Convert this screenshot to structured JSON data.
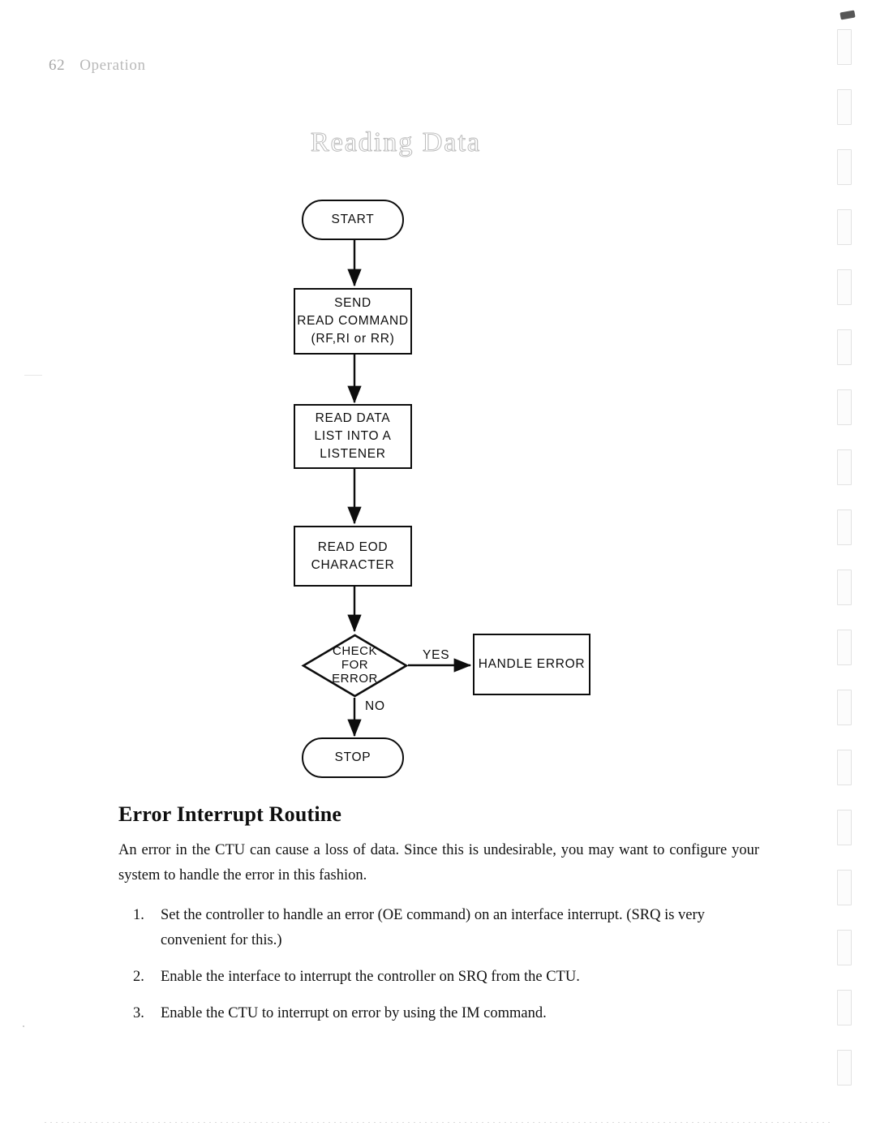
{
  "page": {
    "number": "62",
    "running_head": "Operation",
    "section_title": "Reading Data"
  },
  "flowchart": {
    "nodes": [
      {
        "id": "start",
        "type": "terminal",
        "label": "START"
      },
      {
        "id": "send-command",
        "type": "process",
        "line1": "SEND",
        "line2": "READ COMMAND",
        "line3": "(RF,RI or RR)"
      },
      {
        "id": "read-data",
        "type": "process",
        "line1": "READ DATA",
        "line2": "LIST INTO A",
        "line3": "LISTENER"
      },
      {
        "id": "read-eod",
        "type": "process",
        "line1": "READ EOD",
        "line2": "CHARACTER"
      },
      {
        "id": "check-error",
        "type": "decision",
        "line1": "CHECK",
        "line2": "FOR",
        "line3": "ERROR"
      },
      {
        "id": "handle-error",
        "type": "process",
        "line1": "HANDLE ERROR"
      },
      {
        "id": "stop",
        "type": "terminal",
        "label": "STOP"
      }
    ],
    "edge_labels": {
      "yes": "YES",
      "no": "NO"
    }
  },
  "content": {
    "heading": "Error Interrupt Routine",
    "paragraph": "An error in the CTU can cause a loss of data. Since this is undesirable, you may want to configure your system to handle the error in this fashion.",
    "steps": [
      {
        "num": "1.",
        "text": "Set the controller to handle an error (OE command) on an interface interrupt. (SRQ is very convenient for this.)"
      },
      {
        "num": "2.",
        "text": "Enable the interface to interrupt the controller on SRQ from the CTU."
      },
      {
        "num": "3.",
        "text": "Enable the CTU to interrupt on error by using the IM command."
      }
    ]
  }
}
